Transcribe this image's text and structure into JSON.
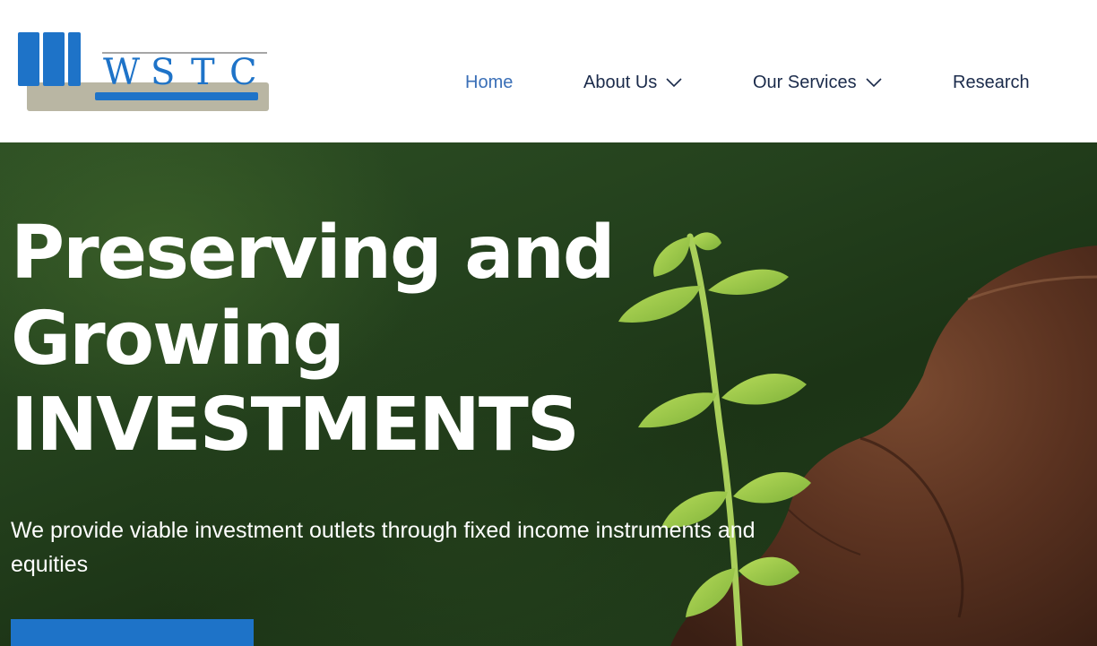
{
  "logo": {
    "text": "WSTC",
    "letters": [
      "W",
      "S",
      "T",
      "C"
    ],
    "colors": {
      "blue": "#1e73c8",
      "gray": "#b9b6a3"
    }
  },
  "nav": {
    "items": [
      {
        "label": "Home",
        "active": true,
        "has_dropdown": false
      },
      {
        "label": "About Us",
        "active": false,
        "has_dropdown": true
      },
      {
        "label": "Our Services",
        "active": false,
        "has_dropdown": true
      },
      {
        "label": "Research",
        "active": false,
        "has_dropdown": false
      }
    ],
    "colors": {
      "text": "#1b2b4b",
      "active": "#3a6fb7"
    }
  },
  "hero": {
    "headline_lines": [
      "Preserving and",
      "Growing",
      "INVESTMENTS"
    ],
    "subheading": "We provide viable investment outlets through fixed income instruments and equities",
    "background_image": "hand-holding-seedling",
    "cta_color": "#1e73c8"
  }
}
